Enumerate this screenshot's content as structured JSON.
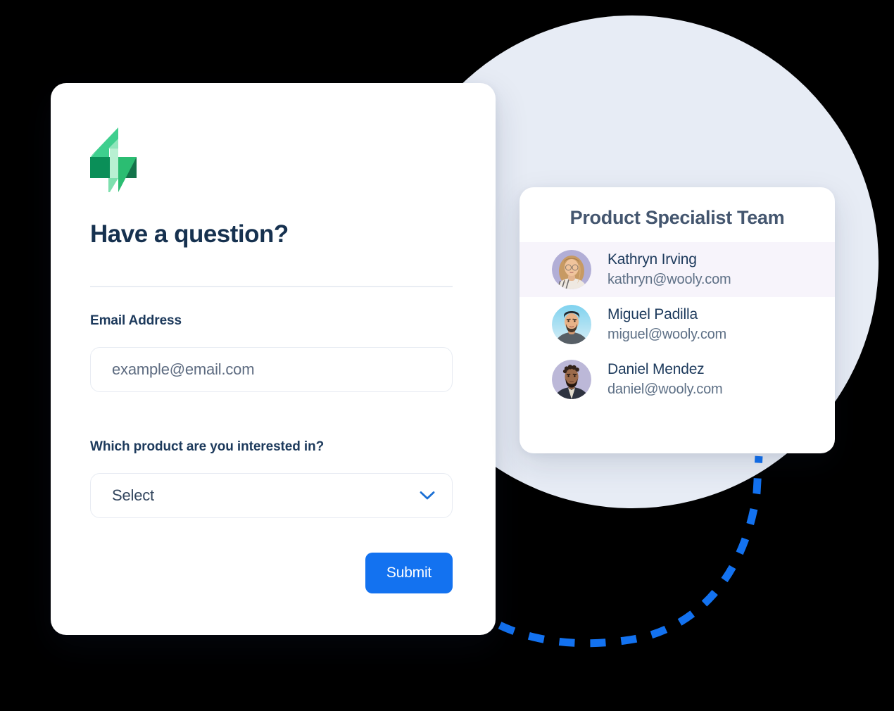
{
  "colors": {
    "background": "#000000",
    "bg_circle": "#e7ecf5",
    "card": "#ffffff",
    "accent_blue": "#1372f0",
    "heading_navy": "#16314f",
    "label_navy": "#1d3a5c",
    "muted_text": "#5e7086",
    "logo_green": "#2bbd72",
    "connector_blue": "#1372f0",
    "row_highlight": "#f7f4fb"
  },
  "form": {
    "logo_icon": "lightning-bolt-logo",
    "title": "Have a question?",
    "email": {
      "label": "Email Address",
      "placeholder": "example@email.com",
      "value": ""
    },
    "product": {
      "label": "Which product are you interested in?",
      "selected": "Select",
      "chevron_icon": "chevron-down-icon"
    },
    "submit_label": "Submit"
  },
  "team": {
    "title": "Product Specialist Team",
    "members": [
      {
        "name": "Kathryn Irving",
        "email": "kathryn@wooly.com",
        "avatar_icon": "avatar-kathryn",
        "highlighted": true
      },
      {
        "name": "Miguel Padilla",
        "email": "miguel@wooly.com",
        "avatar_icon": "avatar-miguel",
        "highlighted": false
      },
      {
        "name": "Daniel Mendez",
        "email": "daniel@wooly.com",
        "avatar_icon": "avatar-daniel",
        "highlighted": false
      }
    ]
  },
  "connector": {
    "icon": "dashed-curve-connector"
  }
}
